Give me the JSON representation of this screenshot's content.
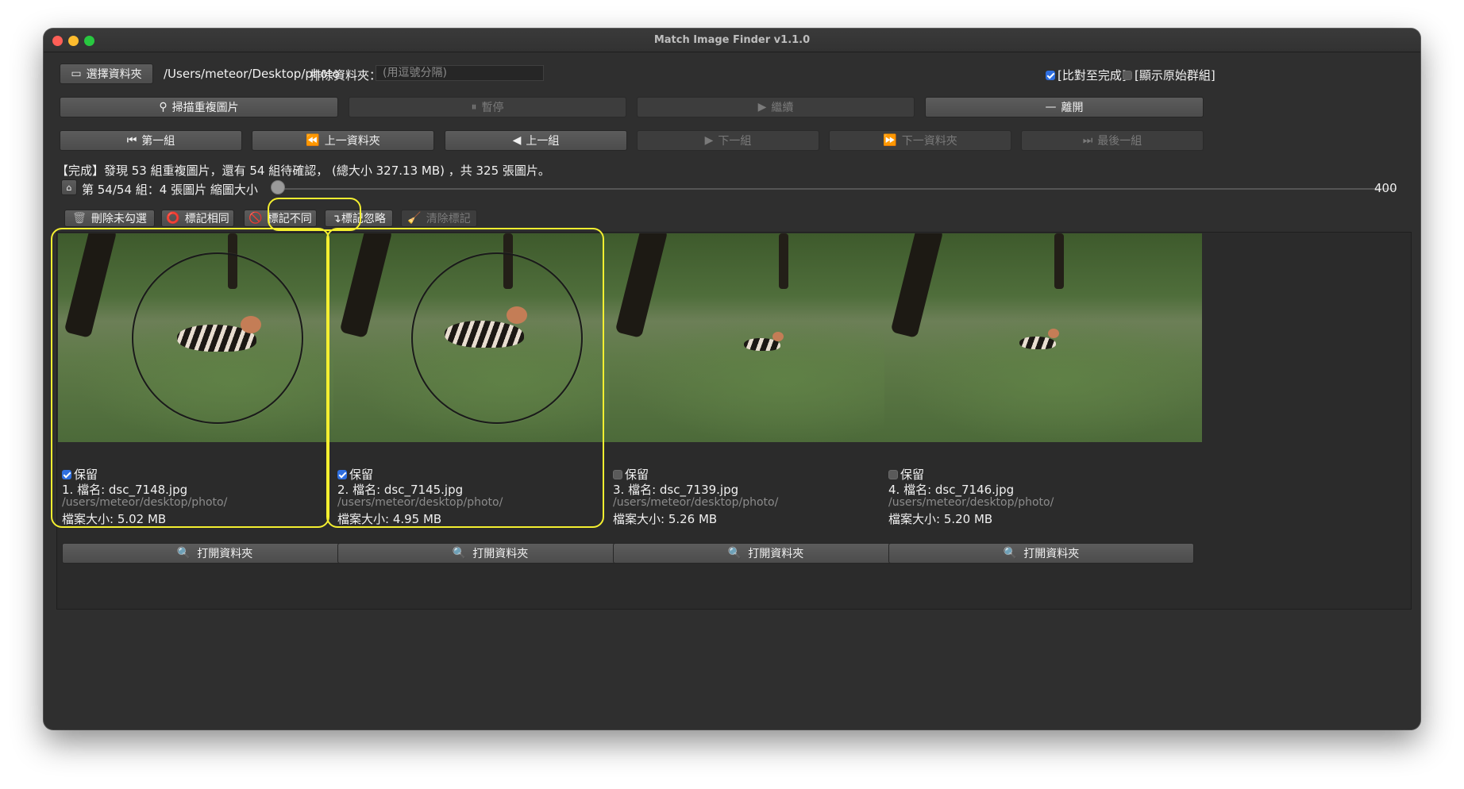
{
  "window": {
    "title": "Match Image Finder v1.1.0"
  },
  "top": {
    "choose_folder": "選擇資料夾",
    "folder_path": "/Users/meteor/Desktop/photo",
    "exclude_label": "排除資料夾：",
    "exclude_placeholder": "(用逗號分隔)",
    "compare_done_label": "[比對至完成]",
    "compare_done_checked": true,
    "show_original_label": "[顯示原始群組]",
    "show_original_checked": false
  },
  "actions": {
    "scan": "掃描重複圖片",
    "pause": "暫停",
    "resume": "繼續",
    "leave": "離開"
  },
  "nav": {
    "first_group": "第一組",
    "prev_folder": "上一資料夾",
    "prev_group": "上一組",
    "next_group": "下一組",
    "next_folder": "下一資料夾",
    "last_group": "最後一組"
  },
  "status": "【完成】發現 53 組重複圖片，還有 54 組待確認， (總大小 327.13 MB) ，共 325 張圖片。",
  "group_info": "第 54/54 組：4 張圖片  縮圖大小",
  "thumb_size": "400",
  "thumb_slider_fraction": 0.0,
  "marks": {
    "delete_unchecked": "刪除未勾選",
    "mark_same": "標記相同",
    "mark_diff": "標記不同",
    "mark_ignore": "↴標記忽略",
    "clear_marks": "清除標記"
  },
  "cards": [
    {
      "keep_label": "保留",
      "keep": true,
      "name": "1. 檔名: dsc_7148.jpg",
      "path": "/users/meteor/desktop/photo/",
      "size": "檔案大小: 5.02 MB",
      "open": "打開資料夾"
    },
    {
      "keep_label": "保留",
      "keep": true,
      "name": "2. 檔名: dsc_7145.jpg",
      "path": "/users/meteor/desktop/photo/",
      "size": "檔案大小: 4.95 MB",
      "open": "打開資料夾"
    },
    {
      "keep_label": "保留",
      "keep": false,
      "name": "3. 檔名: dsc_7139.jpg",
      "path": "/users/meteor/desktop/photo/",
      "size": "檔案大小: 5.26 MB",
      "open": "打開資料夾"
    },
    {
      "keep_label": "保留",
      "keep": false,
      "name": "4. 檔名: dsc_7146.jpg",
      "path": "/users/meteor/desktop/photo/",
      "size": "檔案大小: 5.20 MB",
      "open": "打開資料夾"
    }
  ],
  "colors": {
    "highlight": "#f4ef30",
    "checkbox_on": "#2f6fe0",
    "window_bg": "#2f2f2f"
  }
}
